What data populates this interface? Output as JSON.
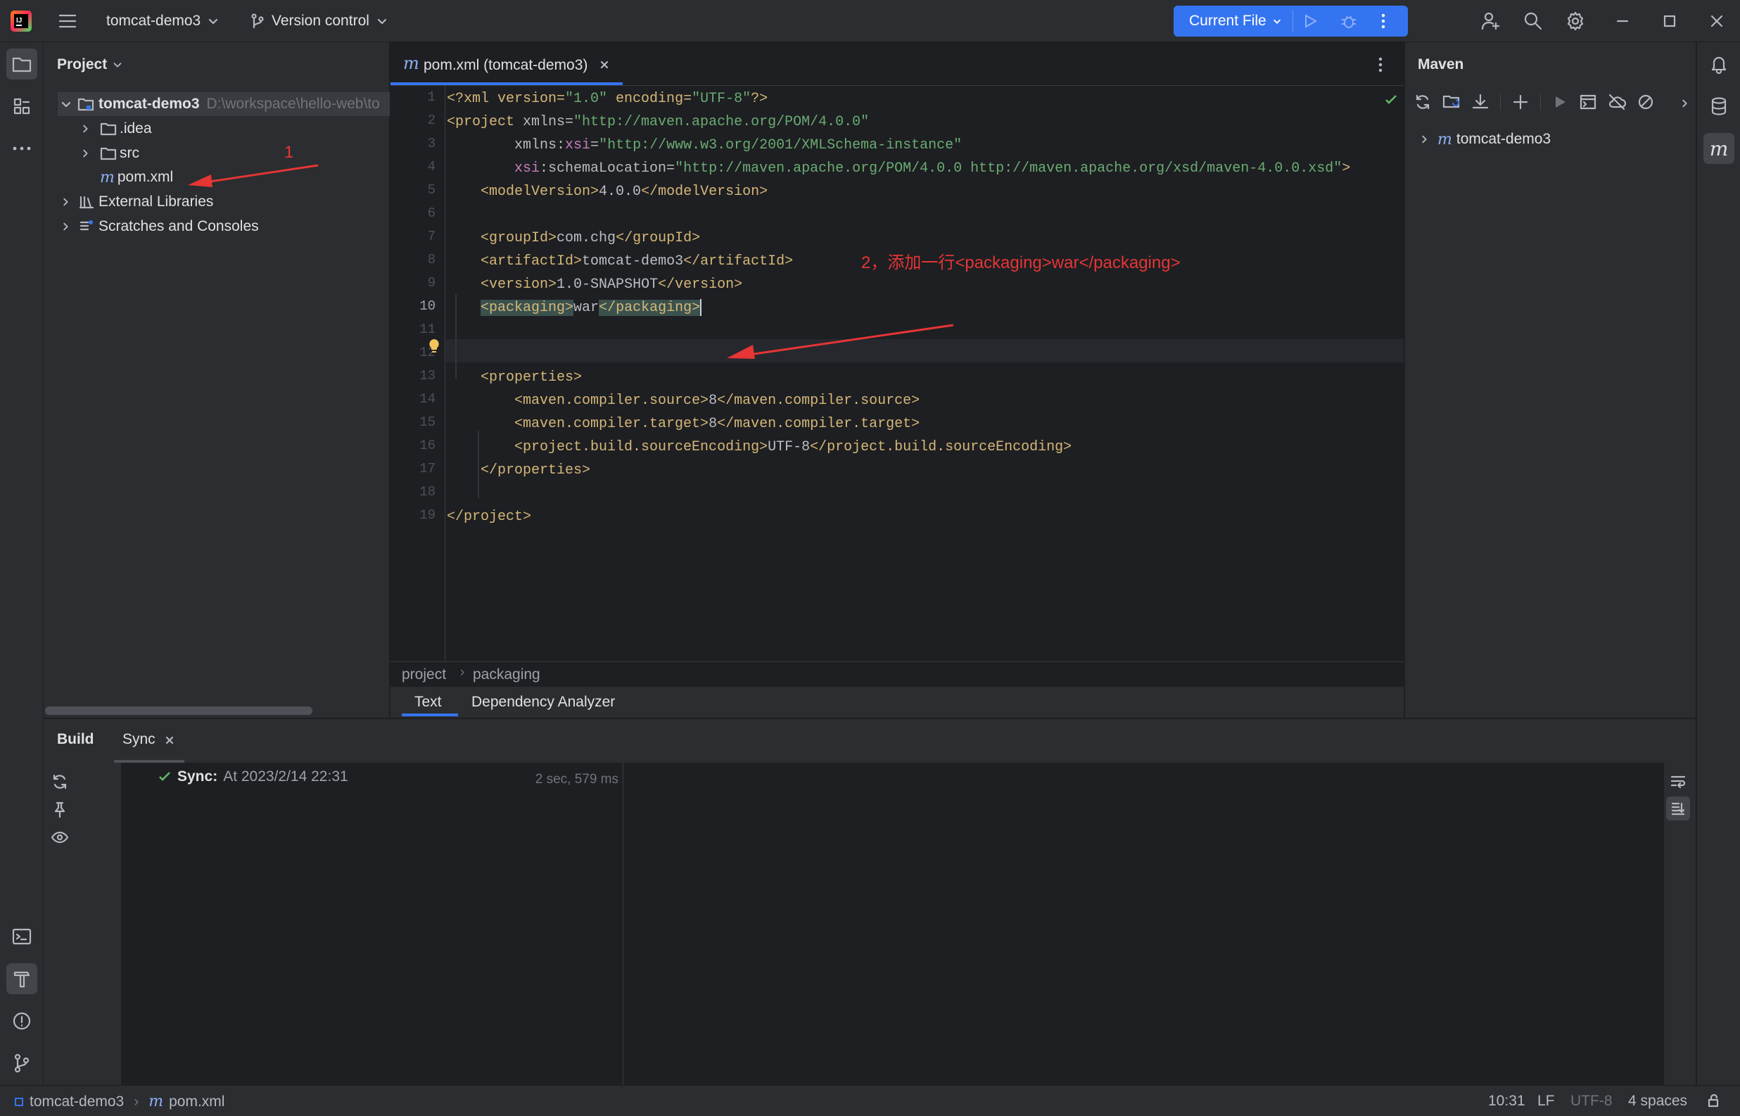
{
  "titlebar": {
    "project_name": "tomcat-demo3",
    "vcs_label": "Version control",
    "run_config": "Current File"
  },
  "project_panel": {
    "title": "Project",
    "root": {
      "name": "tomcat-demo3",
      "path": "D:\\workspace\\hello-web\\to"
    },
    "items": [
      {
        "label": ".idea",
        "type": "folder"
      },
      {
        "label": "src",
        "type": "folder"
      },
      {
        "label": "pom.xml",
        "type": "maven-file"
      },
      {
        "label": "External Libraries",
        "type": "libraries"
      },
      {
        "label": "Scratches and Consoles",
        "type": "scratches"
      }
    ]
  },
  "editor": {
    "tab_label": "pom.xml (tomcat-demo3)",
    "line_numbers": [
      "1",
      "2",
      "3",
      "4",
      "5",
      "6",
      "7",
      "8",
      "9",
      "10",
      "11",
      "12",
      "13",
      "14",
      "15",
      "16",
      "17",
      "18",
      "19"
    ],
    "current_line": "10",
    "breadcrumb": [
      "project",
      "packaging"
    ],
    "bottom_tabs": [
      "Text",
      "Dependency Analyzer"
    ],
    "code": {
      "l1": [
        "<?xml version=",
        "\"1.0\"",
        " encoding=",
        "\"UTF-8\"",
        "?>"
      ],
      "l2": [
        "<project",
        " xmlns=",
        "\"http://maven.apache.org/POM/4.0.0\""
      ],
      "l3": [
        "        xmlns:",
        "xsi",
        "=",
        "\"http://www.w3.org/2001/XMLSchema-instance\""
      ],
      "l4": [
        "        ",
        "xsi",
        ":schemaLocation=",
        "\"http://maven.apache.org/POM/4.0.0 http://maven.apache.org/xsd/maven-4.0.0.xsd\"",
        ">"
      ],
      "l5": [
        "    ",
        "<modelVersion>",
        "4.0.0",
        "</modelVersion>"
      ],
      "l7": [
        "    ",
        "<groupId>",
        "com.chg",
        "</groupId>"
      ],
      "l8": [
        "    ",
        "<artifactId>",
        "tomcat-demo3",
        "</artifactId>"
      ],
      "l9": [
        "    ",
        "<version>",
        "1.0-SNAPSHOT",
        "</version>"
      ],
      "l10": [
        "    ",
        "<packaging>",
        "war",
        "</packaging>"
      ],
      "l13": [
        "    ",
        "<properties>"
      ],
      "l14": [
        "        ",
        "<maven.compiler.source>",
        "8",
        "</maven.compiler.source>"
      ],
      "l15": [
        "        ",
        "<maven.compiler.target>",
        "8",
        "</maven.compiler.target>"
      ],
      "l16": [
        "        ",
        "<project.build.sourceEncoding>",
        "UTF-8",
        "</project.build.sourceEncoding>"
      ],
      "l17": [
        "    ",
        "</properties>"
      ],
      "l19": [
        "</project>"
      ]
    }
  },
  "annotations": {
    "a1": "1",
    "a2": "2，添加一行<packaging>war</packaging>"
  },
  "maven_panel": {
    "title": "Maven",
    "project": "tomcat-demo3"
  },
  "build_panel": {
    "title": "Build",
    "tab": "Sync",
    "sync_label": "Sync:",
    "sync_time": "At 2023/2/14 22:31",
    "duration": "2 sec, 579 ms"
  },
  "statusbar": {
    "project": "tomcat-demo3",
    "file": "pom.xml",
    "position": "10:31",
    "line_sep": "LF",
    "encoding": "UTF-8",
    "indent": "4 spaces"
  },
  "colors": {
    "accent": "#3574f0",
    "annotation": "#e53535",
    "bg_editor": "#1e1f22",
    "bg_panel": "#2b2d30"
  }
}
